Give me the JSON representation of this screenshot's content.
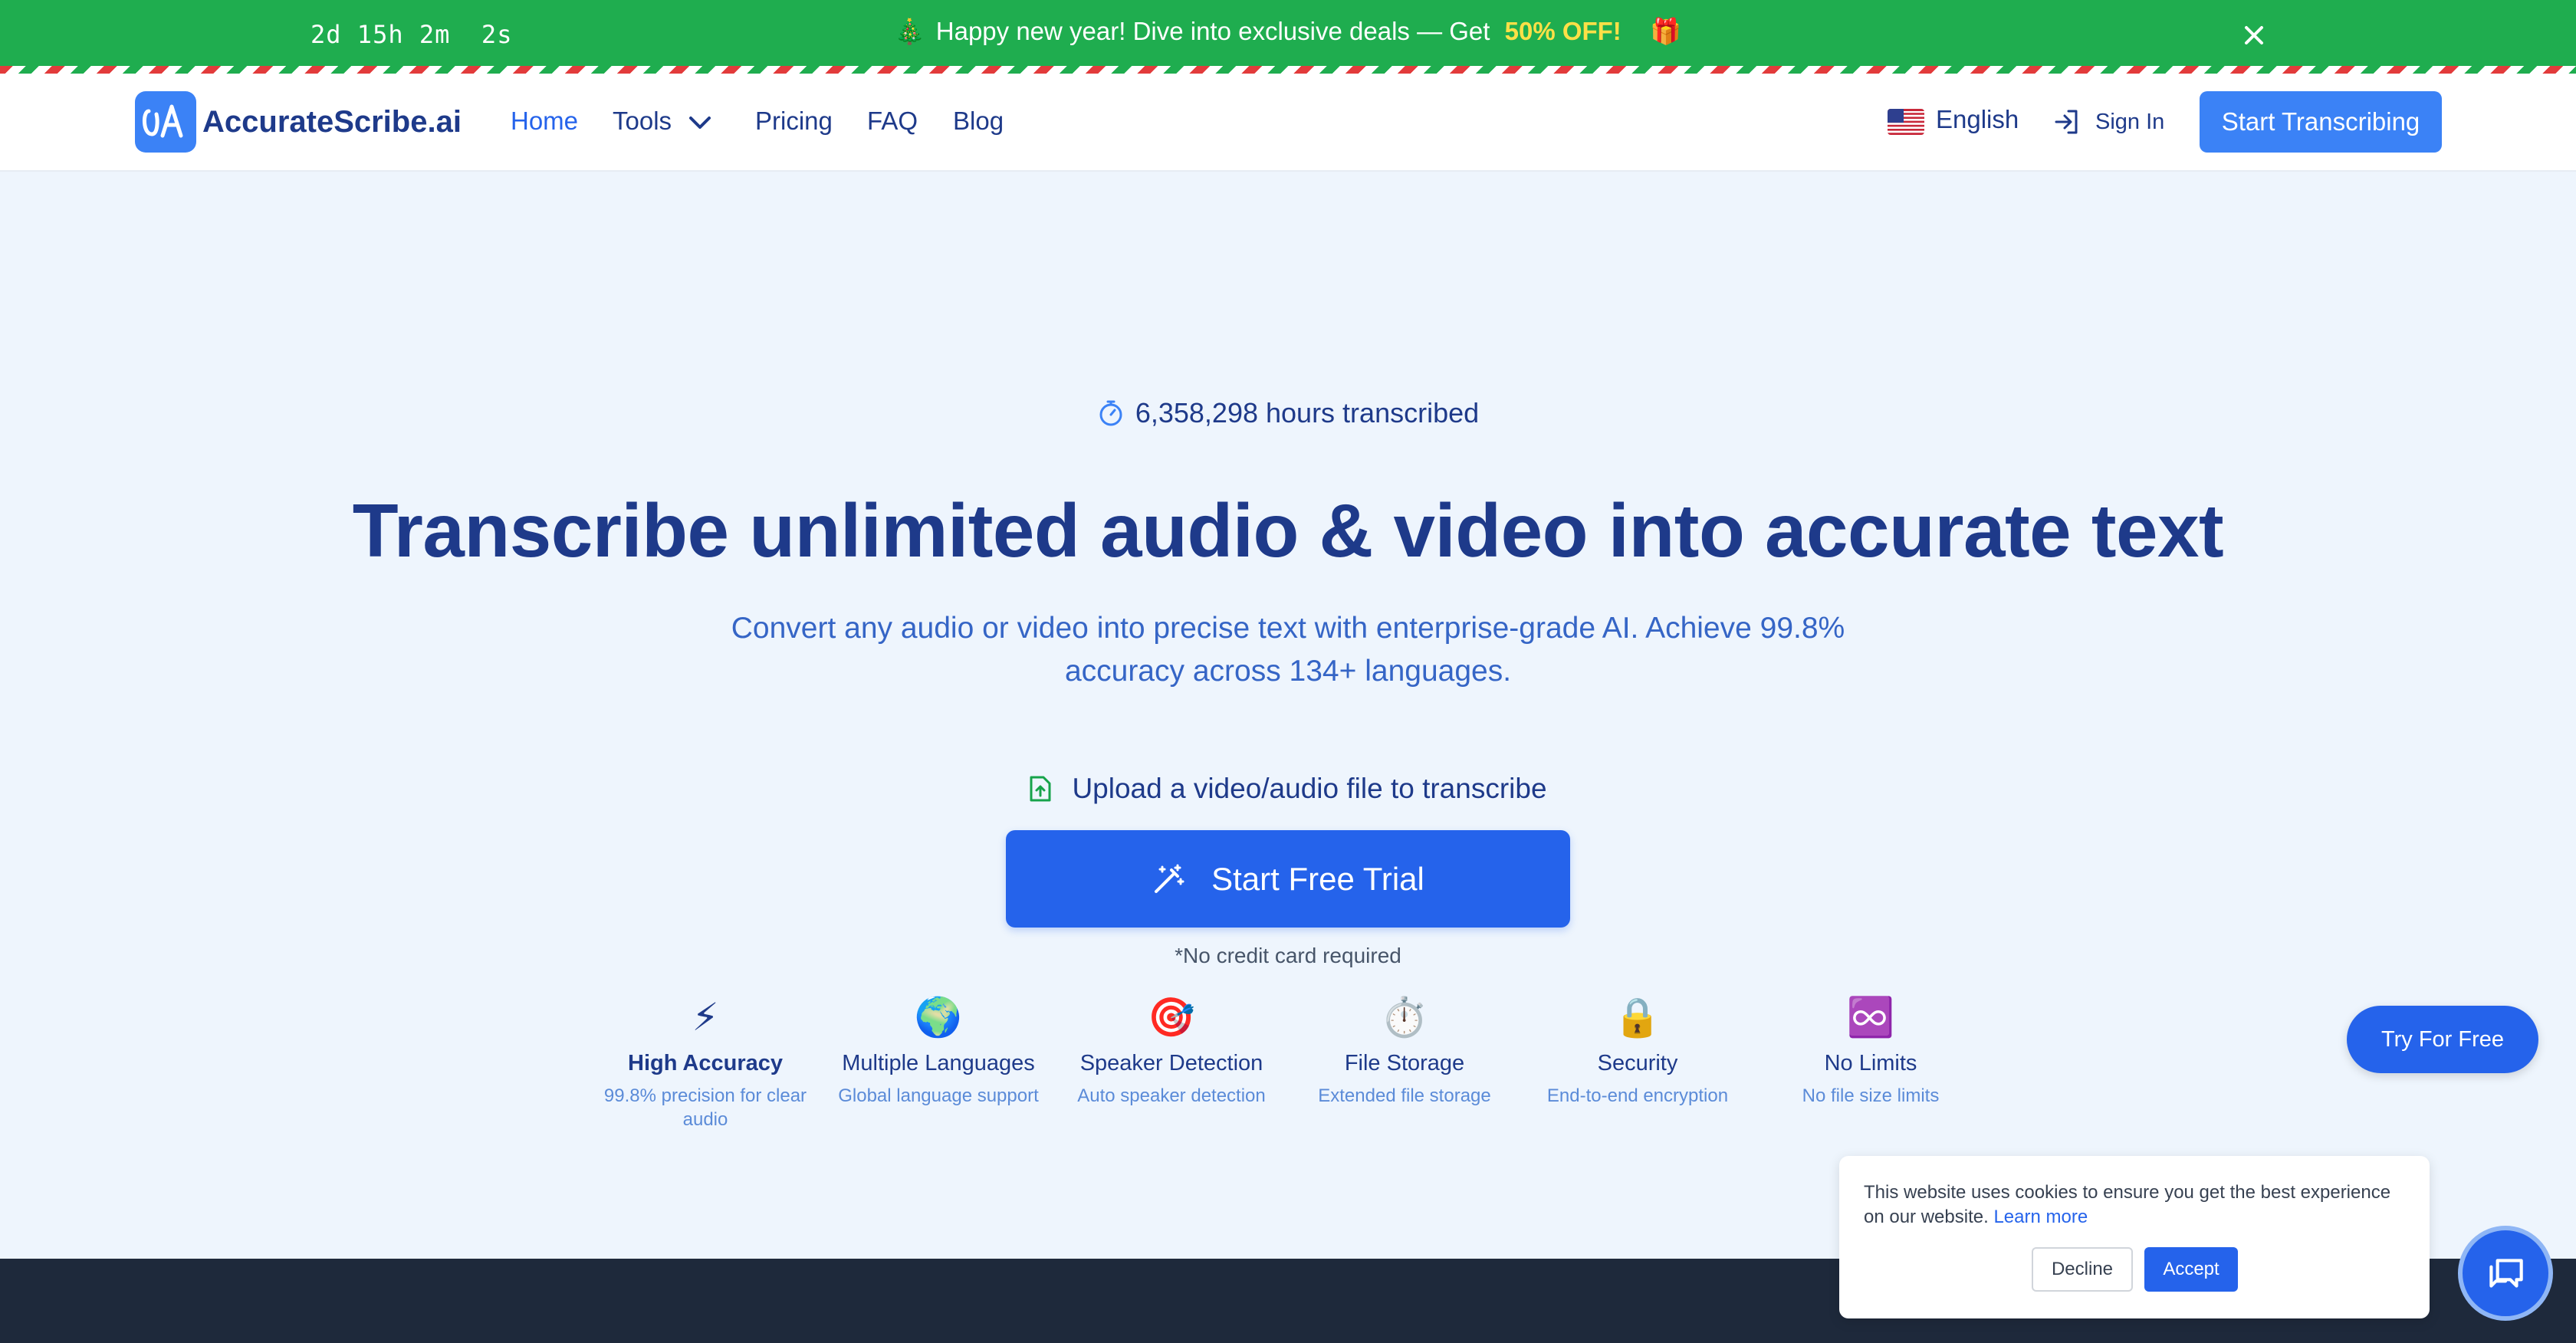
{
  "promo": {
    "timer": "2d 15h 2m  2s",
    "message": "Happy new year! Dive into exclusive deals — Get",
    "discount": "50% OFF!",
    "icons": [
      "christmas-tree-icon",
      "gift-icon",
      "close-icon"
    ]
  },
  "header": {
    "brand": "AccurateScribe.ai",
    "nav": {
      "home": "Home",
      "tools": "Tools",
      "pricing": "Pricing",
      "faq": "FAQ",
      "blog": "Blog"
    },
    "language": "English",
    "sign_in": "Sign In",
    "cta": "Start Transcribing"
  },
  "hero": {
    "stat": "6,358,298 hours transcribed",
    "title": "Transcribe unlimited audio & video into accurate text",
    "subtitle": "Convert any audio or video into precise text with enterprise-grade AI. Achieve 99.8% accuracy across 134+ languages.",
    "upload_label": "Upload a video/audio file to transcribe",
    "trial_button": "Start Free Trial",
    "no_card": "*No credit card required"
  },
  "features": [
    {
      "icon": "⚡",
      "title": "High Accuracy",
      "desc": "99.8% precision for clear audio"
    },
    {
      "icon": "🌍",
      "title": "Multiple Languages",
      "desc": "Global language support"
    },
    {
      "icon": "🎯",
      "title": "Speaker Detection",
      "desc": "Auto speaker detection"
    },
    {
      "icon": "⏱️",
      "title": "File Storage",
      "desc": "Extended file storage"
    },
    {
      "icon": "🔒",
      "title": "Security",
      "desc": "End-to-end encryption"
    },
    {
      "icon": "♾️",
      "title": "No Limits",
      "desc": "No file size limits"
    }
  ],
  "try_free": "Try For Free",
  "cookie": {
    "text": "This website uses cookies to ensure you get the best experience on our website.",
    "learn_more": "Learn more",
    "decline": "Decline",
    "accept": "Accept"
  },
  "colors": {
    "promo_green": "#1fad4f",
    "primary": "#2563eb",
    "cta_blue": "#3b82f6",
    "heading": "#1e3a8a",
    "hero_bg": "#eef5fd",
    "footer": "#1e293b"
  }
}
